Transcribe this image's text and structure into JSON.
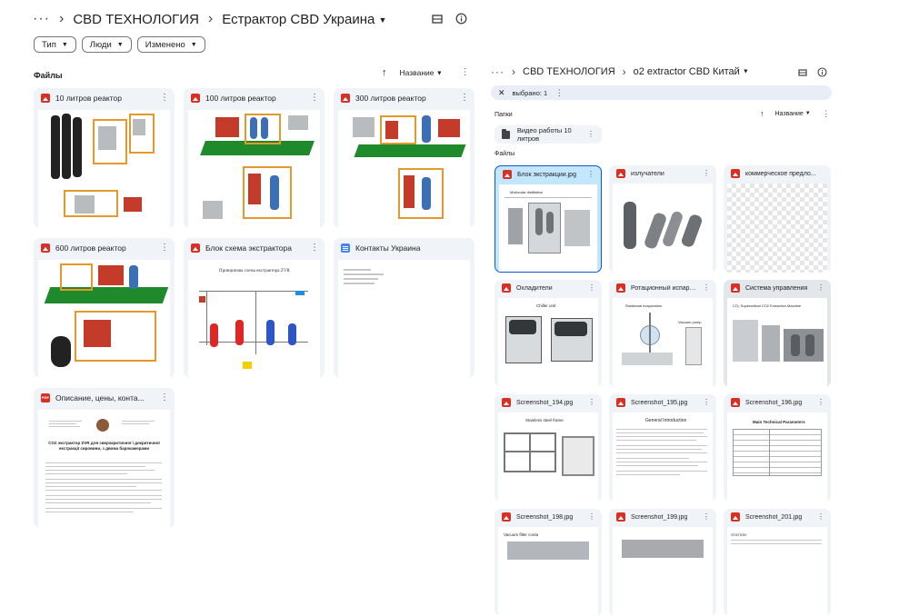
{
  "left": {
    "breadcrumb": {
      "parent": "CBD ТЕХНОЛОГИЯ",
      "current": "Естрактор CBD Украина"
    },
    "filters": [
      {
        "label": "Тип"
      },
      {
        "label": "Люди"
      },
      {
        "label": "Изменено"
      }
    ],
    "section_files": "Файлы",
    "sort_label": "Название",
    "files": [
      {
        "name": "10 литров реактор",
        "type": "image"
      },
      {
        "name": "100 литров реактор",
        "type": "image"
      },
      {
        "name": "300 литров реактор",
        "type": "image"
      },
      {
        "name": "600 литров реактор",
        "type": "image"
      },
      {
        "name": "Блок схема экстрактора",
        "type": "image"
      },
      {
        "name": "Контакты Украина",
        "type": "doc"
      },
      {
        "name": "Описание, цены, конта...",
        "type": "pdf"
      }
    ],
    "thumb_text": {
      "block_scheme_title": "Принципова схема екстрактора ZVR",
      "pdf_heading": "CO2 экстрактор ZVR для сверхкритичної і докритичної екстракції сировини, з двома барокамерами"
    }
  },
  "right": {
    "breadcrumb": {
      "parent": "CBD ТЕХНОЛОГИЯ",
      "current": "o2 extractor CBD Китай"
    },
    "selection": "выбрано: 1",
    "section_folders": "Папки",
    "sort_label": "Название",
    "folders": [
      {
        "name": "Видео работы 10 литров"
      }
    ],
    "section_files": "Файлы",
    "files": [
      {
        "name": "Блок экстракции.jpg",
        "selected": true
      },
      {
        "name": "излучатели"
      },
      {
        "name": "коммерческое предло..."
      },
      {
        "name": "Охладители"
      },
      {
        "name": "Ротационный испарите..."
      },
      {
        "name": "Система управления"
      },
      {
        "name": "Screenshot_194.jpg"
      },
      {
        "name": "Screenshot_195.jpg"
      },
      {
        "name": "Screenshot_196.jpg"
      },
      {
        "name": "Screenshot_198.jpg"
      },
      {
        "name": "Screenshot_199.jpg"
      },
      {
        "name": "Screenshot_201.jpg"
      }
    ],
    "thumb_text": {
      "t0": "Molecular distillation",
      "t3": "Chiller unit",
      "t4": "Rotational evaporation",
      "t4b": "Vacuum pump",
      "t5": "CO₂ Supercritical CO2 Extraction Machine",
      "t6": "Stainless steel frame",
      "t7": "General Introduction",
      "t8": "Main Technical Parameters",
      "t9": "Vacuum filter conta",
      "t11": "STATION"
    }
  }
}
